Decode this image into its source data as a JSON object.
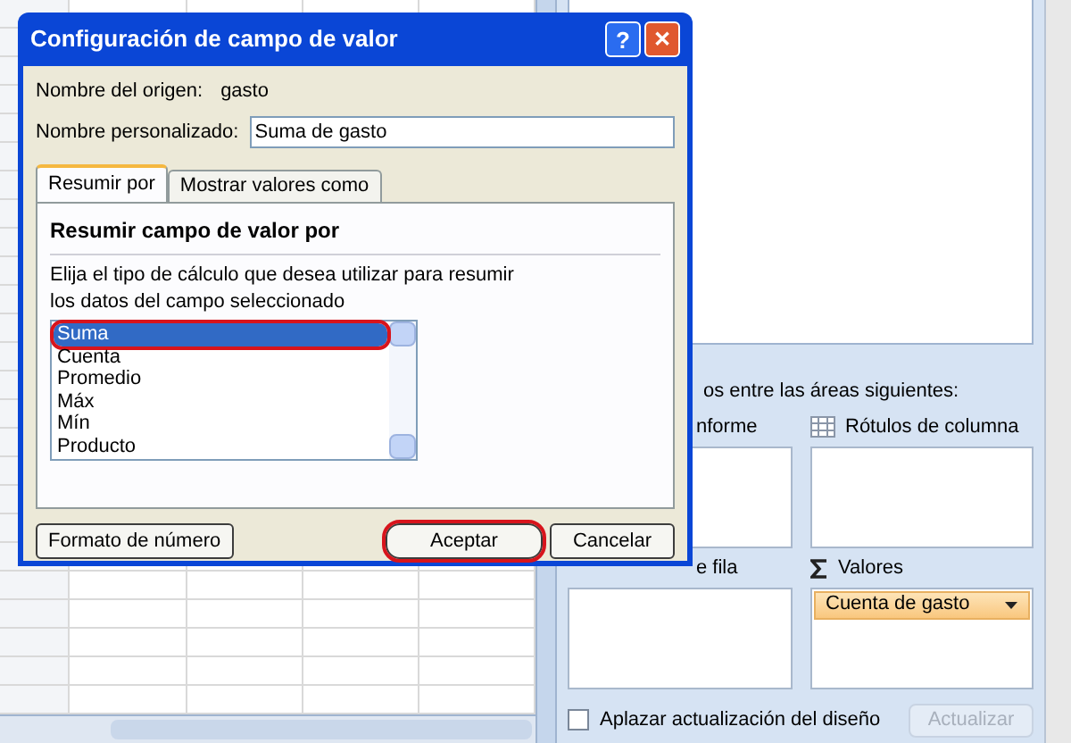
{
  "dialog": {
    "title": "Configuración de campo de valor",
    "help": "?",
    "close": "✕",
    "source_label": "Nombre del origen:",
    "source_value": "gasto",
    "custom_label": "Nombre personalizado:",
    "custom_value": "Suma de gasto",
    "tabs": [
      {
        "label": "Resumir por",
        "selected": true
      },
      {
        "label": "Mostrar valores como",
        "selected": false
      }
    ],
    "heading": "Resumir campo de valor por",
    "description": "Elija el tipo de cálculo que desea utilizar para resumir los datos del campo seleccionado",
    "functions": [
      {
        "label": "Suma",
        "selected": true,
        "circled": true
      },
      {
        "label": "Cuenta",
        "selected": false,
        "circled": false
      },
      {
        "label": "Promedio",
        "selected": false,
        "circled": false
      },
      {
        "label": "Máx",
        "selected": false,
        "circled": false
      },
      {
        "label": "Mín",
        "selected": false,
        "circled": false
      },
      {
        "label": "Producto",
        "selected": false,
        "circled": false
      }
    ],
    "buttons": [
      {
        "label": "Formato de número",
        "circled": false
      },
      {
        "label": "Aceptar",
        "circled": true
      },
      {
        "label": "Cancelar",
        "circled": false
      }
    ]
  },
  "pivot_panel": {
    "instruction": "os entre las áreas siguientes:",
    "areas": [
      {
        "label": "nforme"
      },
      {
        "label": "Rótulos de columna"
      },
      {
        "label": "e fila"
      },
      {
        "label": "Valores",
        "items": [
          "Cuenta de gasto"
        ]
      }
    ],
    "defer": {
      "label": "Aplazar actualización del diseño",
      "checked": false
    },
    "update": {
      "label": "Actualizar",
      "disabled": true
    }
  }
}
